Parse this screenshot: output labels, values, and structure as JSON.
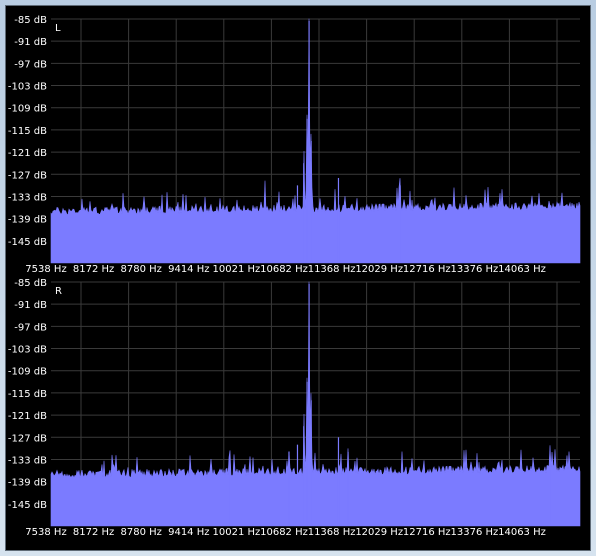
{
  "colors": {
    "background": "#000000",
    "grid": "#3a3a3a",
    "spectrum": "#7b7bff",
    "text": "#ffffff"
  },
  "chart_data": [
    {
      "type": "area",
      "channel_label": "L",
      "ylim": [
        -85,
        -151
      ],
      "y_ticks": [
        "-85 dB",
        "-91 dB",
        "-97 dB",
        "-103 dB",
        "-109 dB",
        "-115 dB",
        "-121 dB",
        "-127 dB",
        "-133 dB",
        "-139 dB",
        "-145 dB"
      ],
      "x_ticks": [
        "7538 Hz",
        "8172 Hz",
        "8780 Hz",
        "9414 Hz",
        "10021 Hz",
        "10682 Hz",
        "11368 Hz",
        "12029 Hz",
        "12716 Hz",
        "13376 Hz",
        "14063 Hz"
      ],
      "xlim": [
        7538,
        14700
      ],
      "noise_floor_db": -137,
      "peaks": [
        {
          "hz": 11032,
          "db": -85.5
        },
        {
          "hz": 11005,
          "db": -112
        },
        {
          "hz": 11060,
          "db": -118
        },
        {
          "hz": 10960,
          "db": -124
        },
        {
          "hz": 10875,
          "db": -130
        },
        {
          "hz": 11430,
          "db": -128
        },
        {
          "hz": 12265,
          "db": -130
        },
        {
          "hz": 10430,
          "db": -134
        }
      ]
    },
    {
      "type": "area",
      "channel_label": "R",
      "ylim": [
        -85,
        -151
      ],
      "y_ticks": [
        "-85 dB",
        "-91 dB",
        "-97 dB",
        "-103 dB",
        "-109 dB",
        "-115 dB",
        "-121 dB",
        "-127 dB",
        "-133 dB",
        "-139 dB",
        "-145 dB"
      ],
      "x_ticks": [
        "7538 Hz",
        "8172 Hz",
        "8780 Hz",
        "9414 Hz",
        "10021 Hz",
        "10682 Hz",
        "11368 Hz",
        "12029 Hz",
        "12716 Hz",
        "13376 Hz",
        "14063 Hz"
      ],
      "xlim": [
        7538,
        14700
      ],
      "noise_floor_db": -137,
      "peaks": [
        {
          "hz": 11032,
          "db": -85.5
        },
        {
          "hz": 11005,
          "db": -112
        },
        {
          "hz": 11060,
          "db": -117
        },
        {
          "hz": 10960,
          "db": -124
        },
        {
          "hz": 10875,
          "db": -129
        },
        {
          "hz": 11430,
          "db": -127
        },
        {
          "hz": 11560,
          "db": -131
        },
        {
          "hz": 10760,
          "db": -131
        },
        {
          "hz": 9960,
          "db": -132
        },
        {
          "hz": 14290,
          "db": -133
        }
      ]
    }
  ]
}
